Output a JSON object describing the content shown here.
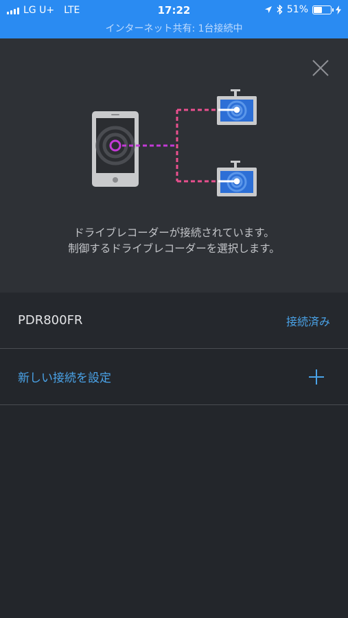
{
  "status_bar": {
    "carrier": "LG U+",
    "network": "LTE",
    "time": "17:22",
    "battery_percent": "51%",
    "battery_level": 0.51,
    "hotspot_text": "インターネット共有: 1台接続中",
    "icons": [
      "signal-icon",
      "location-icon",
      "bluetooth-icon",
      "battery-icon",
      "charging-icon"
    ]
  },
  "header": {
    "close_icon": "close-icon",
    "message_line1": "ドライブレコーダーが接続されています。",
    "message_line2": "制御するドライブレコーダーを選択します。"
  },
  "devices": [
    {
      "name": "PDR800FR",
      "status": "接続済み"
    }
  ],
  "new_connection": {
    "label": "新しい接続を設定",
    "icon": "plus-icon"
  },
  "colors": {
    "status_bar": "#2a8bf2",
    "accent_blue": "#4aa3e8",
    "pink_dash": "#e9508f",
    "purple_ring": "#c33ad6",
    "background": "#23262b",
    "header_bg": "#2e3136"
  }
}
